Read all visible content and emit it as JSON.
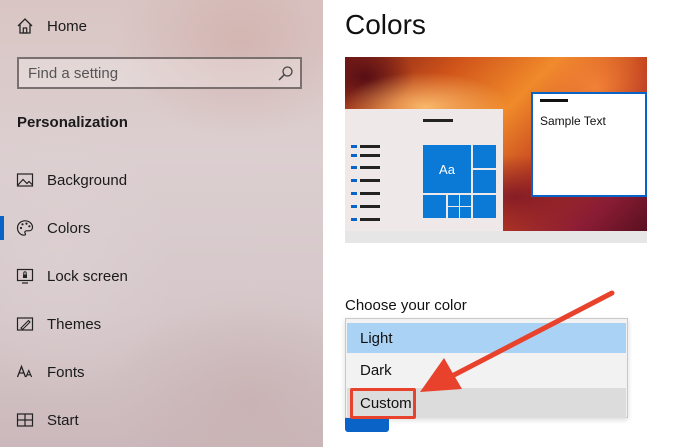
{
  "sidebar": {
    "home_label": "Home",
    "search_placeholder": "Find a setting",
    "section_title": "Personalization",
    "items": [
      {
        "label": "Background",
        "icon": "image-icon"
      },
      {
        "label": "Colors",
        "icon": "palette-icon",
        "active": true
      },
      {
        "label": "Lock screen",
        "icon": "lock-screen-icon"
      },
      {
        "label": "Themes",
        "icon": "themes-icon"
      },
      {
        "label": "Fonts",
        "icon": "fonts-icon"
      },
      {
        "label": "Start",
        "icon": "start-icon"
      }
    ]
  },
  "main": {
    "title": "Colors",
    "preview": {
      "sample_text": "Sample Text",
      "tile_text": "Aa"
    },
    "choose_color": {
      "label": "Choose your color",
      "options": [
        "Light",
        "Dark",
        "Custom"
      ],
      "selected": "Light",
      "highlighted": "Custom"
    }
  },
  "colors": {
    "accent": "#0a64c8",
    "annotation": "#e8422d",
    "selected_option": "#a9d2f5"
  }
}
